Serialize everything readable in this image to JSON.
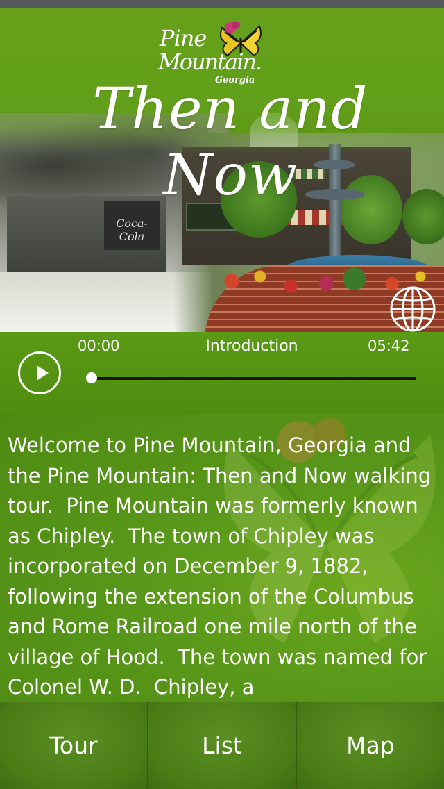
{
  "header": {
    "logo_line1": "Pine",
    "logo_line2": "Mountain.",
    "logo_line3": "Georgia",
    "old_photo_sign": "Coca-Cola",
    "title": "Then and Now"
  },
  "player": {
    "current_time": "00:00",
    "track_title": "Introduction",
    "total_time": "05:42",
    "progress": 0
  },
  "content": {
    "text": "Welcome to Pine Mountain, Georgia and the Pine Mountain: Then and Now walking tour.  Pine Mountain was formerly known as Chipley.  The town of Chipley was incorporated on December 9, 1882, following the extension of the Columbus and Rome Railroad one mile north of the village of Hood.  The town was named for Colonel W. D.  Chipley, a"
  },
  "tabs": [
    {
      "label": "Tour"
    },
    {
      "label": "List"
    },
    {
      "label": "Map"
    }
  ],
  "icons": {
    "play": "play-icon",
    "globe": "globe-icon",
    "butterfly": "butterfly-icon"
  },
  "colors": {
    "background": "#4f8a10",
    "text": "#ffffff",
    "progress_track": "#141a08"
  }
}
